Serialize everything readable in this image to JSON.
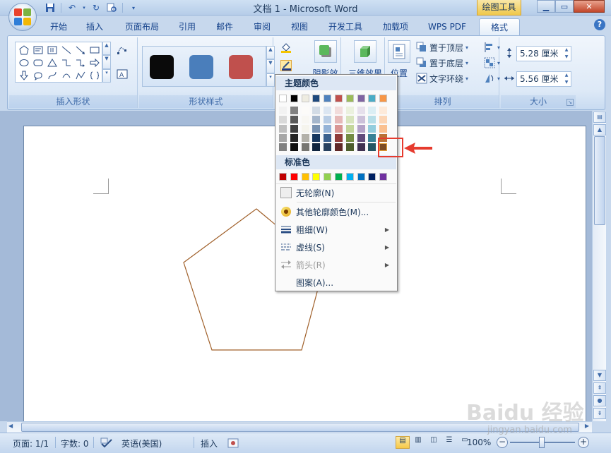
{
  "titlebar": {
    "doc_title": "文档 1 - Microsoft Word",
    "context_tool": "绘图工具"
  },
  "tabs": [
    "开始",
    "插入",
    "页面布局",
    "引用",
    "邮件",
    "审阅",
    "视图",
    "开发工具",
    "加载项",
    "WPS PDF",
    "格式"
  ],
  "active_tab": "格式",
  "ribbon": {
    "groups": {
      "insert_shapes": "插入形状",
      "shape_styles": "形状样式",
      "arrange": "排列",
      "size": "大小"
    },
    "shadow_effect": "阴影效果",
    "three_d_effect": "三维效果",
    "position": "位置",
    "bring_to_front": "置于顶层",
    "send_to_back": "置于底层",
    "text_wrap": "文字环绕",
    "height_value": "5.28 厘米",
    "width_value": "5.56 厘米",
    "style_colors": [
      "#0a0a0a",
      "#4a7ebb",
      "#c0504d"
    ]
  },
  "menu": {
    "theme_colors_title": "主题颜色",
    "standard_colors_title": "标准色",
    "theme_top_row": [
      "#ffffff",
      "#000000",
      "#eeece1",
      "#1f497d",
      "#4f81bd",
      "#c0504d",
      "#9bbb59",
      "#8064a2",
      "#4bacc6",
      "#f79646"
    ],
    "standard_colors": [
      "#c00000",
      "#ff0000",
      "#ffc000",
      "#ffff00",
      "#92d050",
      "#00b050",
      "#00b0f0",
      "#0070c0",
      "#002060",
      "#7030a0"
    ],
    "items": {
      "no_outline": "无轮廓(N)",
      "more_colors": "其他轮廓颜色(M)...",
      "weight": "粗细(W)",
      "dashes": "虚线(S)",
      "arrows": "箭头(R)",
      "pattern": "图案(A)..."
    }
  },
  "statusbar": {
    "page": "页面: 1/1",
    "words": "字数: 0",
    "language": "英语(美国)",
    "mode": "插入",
    "zoom": "100%"
  },
  "watermark": {
    "brand": "Baidu 经验",
    "url": "jingyan.baidu.com"
  },
  "pentagon_color": "#a0602a"
}
